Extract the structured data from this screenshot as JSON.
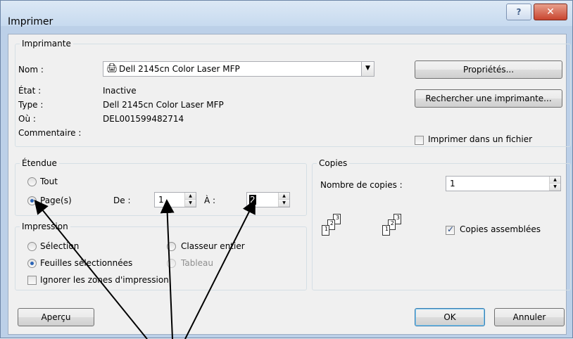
{
  "window": {
    "title": "Imprimer"
  },
  "printer": {
    "group_label": "Imprimante",
    "name_label": "Nom :",
    "name_value": "Dell 2145cn Color Laser MFP",
    "state_label": "État :",
    "state_value": "Inactive",
    "type_label": "Type :",
    "type_value": "Dell 2145cn Color Laser MFP",
    "where_label": "Où :",
    "where_value": "DEL001599482714",
    "comment_label": "Commentaire :",
    "properties_button": "Propriétés...",
    "find_button": "Rechercher une imprimante...",
    "print_to_file_label": "Imprimer dans un fichier"
  },
  "range": {
    "group_label": "Étendue",
    "all_label": "Tout",
    "pages_label": "Page(s)",
    "from_label": "De :",
    "from_value": "1",
    "to_label": "À :",
    "to_value": "2"
  },
  "copies": {
    "group_label": "Copies",
    "count_label": "Nombre de copies :",
    "count_value": "1",
    "collate_label": "Copies assemblées"
  },
  "print_what": {
    "group_label": "Impression",
    "selection_label": "Sélection",
    "active_sheets_label": "Feuilles sélectionnées",
    "workbook_label": "Classeur entier",
    "table_label": "Tableau",
    "ignore_areas_label": "Ignorer les zones d'impression"
  },
  "footer": {
    "preview_button": "Aperçu",
    "ok_button": "OK",
    "cancel_button": "Annuler"
  }
}
